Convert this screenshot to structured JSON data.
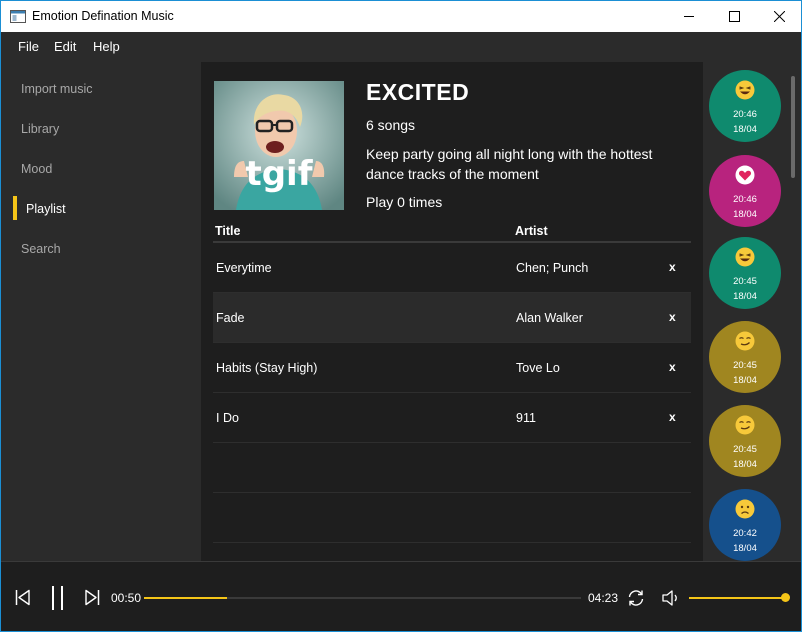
{
  "window": {
    "title": "Emotion Defination Music"
  },
  "menu": [
    "File",
    "Edit",
    "Help"
  ],
  "nav": {
    "items": [
      {
        "label": "Import music"
      },
      {
        "label": "Library"
      },
      {
        "label": "Mood"
      },
      {
        "label": "Playlist",
        "active": true
      },
      {
        "label": "Search"
      }
    ]
  },
  "playlist": {
    "name": "EXCITED",
    "song_count": "6 songs",
    "description": "Keep party going all night long with the hottest dance tracks of the moment",
    "plays": "Play 0 times",
    "cover_text": "tgif"
  },
  "table": {
    "headers": {
      "title": "Title",
      "artist": "Artist"
    },
    "remove_glyph": "x",
    "rows": [
      {
        "title": "Everytime",
        "artist": "Chen; Punch"
      },
      {
        "title": "Fade",
        "artist": "Alan Walker"
      },
      {
        "title": "Habits (Stay High)",
        "artist": "Tove Lo"
      },
      {
        "title": "I Do",
        "artist": "911"
      }
    ]
  },
  "history": [
    {
      "emotion": "laughing-emoji-icon",
      "time": "20:46",
      "date": "18/04",
      "color": "#0f8a6e"
    },
    {
      "emotion": "heart-emoji-icon",
      "time": "20:46",
      "date": "18/04",
      "color": "#b8237e"
    },
    {
      "emotion": "laughing-emoji-icon",
      "time": "20:45",
      "date": "18/04",
      "color": "#0f8a6e"
    },
    {
      "emotion": "smirk-emoji-icon",
      "time": "20:45",
      "date": "18/04",
      "color": "#a08620"
    },
    {
      "emotion": "smirk-emoji-icon",
      "time": "20:45",
      "date": "18/04",
      "color": "#a08620"
    },
    {
      "emotion": "sad-emoji-icon",
      "time": "20:42",
      "date": "18/04",
      "color": "#15508c"
    }
  ],
  "player": {
    "current_time": "00:50",
    "total_time": "04:23",
    "progress_percent": 19,
    "volume_percent": 100,
    "icons": [
      "skip-previous-icon",
      "pause-icon",
      "skip-next-icon",
      "repeat-icon",
      "volume-icon"
    ]
  },
  "colors": {
    "accent": "#f5c518",
    "panel": "#2b2b2b",
    "background": "#1e1e1e"
  }
}
